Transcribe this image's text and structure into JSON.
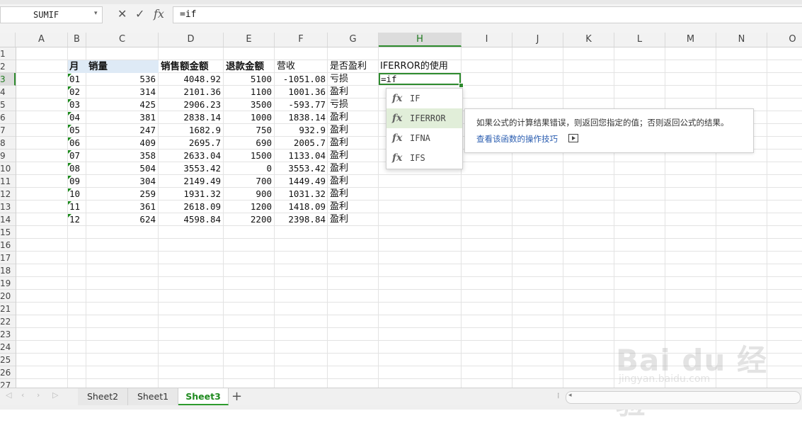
{
  "formula_bar": {
    "name_box": "SUMIF",
    "cancel_icon": "✕",
    "confirm_icon": "✓",
    "fx_label": "fx",
    "formula": "=if"
  },
  "columns": [
    "A",
    "B",
    "C",
    "D",
    "E",
    "F",
    "G",
    "H",
    "I",
    "J",
    "K",
    "L",
    "M",
    "N",
    "O"
  ],
  "selected_column": "H",
  "rows": [
    "1",
    "2",
    "3",
    "4",
    "5",
    "6",
    "7",
    "8",
    "9",
    "10",
    "11",
    "12",
    "13",
    "14",
    "15",
    "16",
    "17",
    "18",
    "19",
    "20",
    "21",
    "22",
    "23",
    "24",
    "25",
    "26",
    "27"
  ],
  "selected_row": "3",
  "table": {
    "headers": {
      "month": "月",
      "sales": "销量",
      "amount": "销售额金额",
      "refund": "退款金额",
      "revenue": "营收",
      "profit": "是否盈利",
      "note": "IFERROR的使用"
    },
    "data": [
      {
        "month": "01",
        "sales": "536",
        "amount": "4048.92",
        "refund": "5100",
        "revenue": "-1051.08",
        "profit": "亏损"
      },
      {
        "month": "02",
        "sales": "314",
        "amount": "2101.36",
        "refund": "1100",
        "revenue": "1001.36",
        "profit": "盈利"
      },
      {
        "month": "03",
        "sales": "425",
        "amount": "2906.23",
        "refund": "3500",
        "revenue": "-593.77",
        "profit": "亏损"
      },
      {
        "month": "04",
        "sales": "381",
        "amount": "2838.14",
        "refund": "1000",
        "revenue": "1838.14",
        "profit": "盈利"
      },
      {
        "month": "05",
        "sales": "247",
        "amount": "1682.9",
        "refund": "750",
        "revenue": "932.9",
        "profit": "盈利"
      },
      {
        "month": "06",
        "sales": "409",
        "amount": "2695.7",
        "refund": "690",
        "revenue": "2005.7",
        "profit": "盈利"
      },
      {
        "month": "07",
        "sales": "358",
        "amount": "2633.04",
        "refund": "1500",
        "revenue": "1133.04",
        "profit": "盈利"
      },
      {
        "month": "08",
        "sales": "504",
        "amount": "3553.42",
        "refund": "0",
        "revenue": "3553.42",
        "profit": "盈利"
      },
      {
        "month": "09",
        "sales": "304",
        "amount": "2149.49",
        "refund": "700",
        "revenue": "1449.49",
        "profit": "盈利"
      },
      {
        "month": "10",
        "sales": "259",
        "amount": "1931.32",
        "refund": "900",
        "revenue": "1031.32",
        "profit": "盈利"
      },
      {
        "month": "11",
        "sales": "361",
        "amount": "2618.09",
        "refund": "1200",
        "revenue": "1418.09",
        "profit": "盈利"
      },
      {
        "month": "12",
        "sales": "624",
        "amount": "4598.84",
        "refund": "2200",
        "revenue": "2398.84",
        "profit": "盈利"
      }
    ],
    "active_cell_text": "=if"
  },
  "autocomplete": {
    "fx_glyph": "fx",
    "items": [
      "IF",
      "IFERROR",
      "IFNA",
      "IFS"
    ],
    "selected_index": 1
  },
  "tooltip": {
    "description": "如果公式的计算结果错误，则返回您指定的值；否则返回公式的结果。",
    "link": "查看该函数的操作技巧"
  },
  "sheets": {
    "tabs": [
      "Sheet2",
      "Sheet1",
      "Sheet3"
    ],
    "active": "Sheet3",
    "add": "+"
  },
  "watermark": {
    "main": "Bai du 经验",
    "sub": "jingyan.baidu.com"
  }
}
